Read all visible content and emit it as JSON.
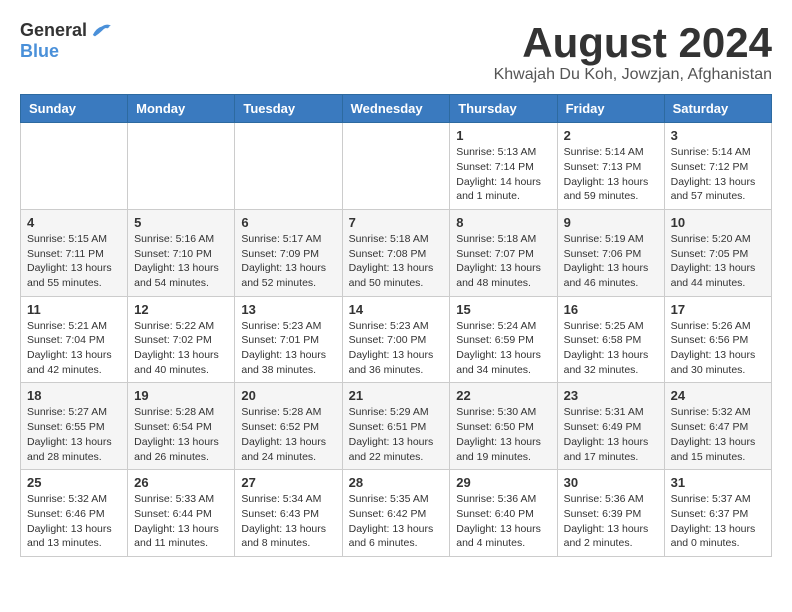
{
  "header": {
    "logo": {
      "general": "General",
      "blue": "Blue"
    },
    "title": "August 2024",
    "location": "Khwajah Du Koh, Jowzjan, Afghanistan"
  },
  "weekdays": [
    "Sunday",
    "Monday",
    "Tuesday",
    "Wednesday",
    "Thursday",
    "Friday",
    "Saturday"
  ],
  "weeks": [
    [
      {
        "day": "",
        "info": ""
      },
      {
        "day": "",
        "info": ""
      },
      {
        "day": "",
        "info": ""
      },
      {
        "day": "",
        "info": ""
      },
      {
        "day": "1",
        "info": "Sunrise: 5:13 AM\nSunset: 7:14 PM\nDaylight: 14 hours\nand 1 minute."
      },
      {
        "day": "2",
        "info": "Sunrise: 5:14 AM\nSunset: 7:13 PM\nDaylight: 13 hours\nand 59 minutes."
      },
      {
        "day": "3",
        "info": "Sunrise: 5:14 AM\nSunset: 7:12 PM\nDaylight: 13 hours\nand 57 minutes."
      }
    ],
    [
      {
        "day": "4",
        "info": "Sunrise: 5:15 AM\nSunset: 7:11 PM\nDaylight: 13 hours\nand 55 minutes."
      },
      {
        "day": "5",
        "info": "Sunrise: 5:16 AM\nSunset: 7:10 PM\nDaylight: 13 hours\nand 54 minutes."
      },
      {
        "day": "6",
        "info": "Sunrise: 5:17 AM\nSunset: 7:09 PM\nDaylight: 13 hours\nand 52 minutes."
      },
      {
        "day": "7",
        "info": "Sunrise: 5:18 AM\nSunset: 7:08 PM\nDaylight: 13 hours\nand 50 minutes."
      },
      {
        "day": "8",
        "info": "Sunrise: 5:18 AM\nSunset: 7:07 PM\nDaylight: 13 hours\nand 48 minutes."
      },
      {
        "day": "9",
        "info": "Sunrise: 5:19 AM\nSunset: 7:06 PM\nDaylight: 13 hours\nand 46 minutes."
      },
      {
        "day": "10",
        "info": "Sunrise: 5:20 AM\nSunset: 7:05 PM\nDaylight: 13 hours\nand 44 minutes."
      }
    ],
    [
      {
        "day": "11",
        "info": "Sunrise: 5:21 AM\nSunset: 7:04 PM\nDaylight: 13 hours\nand 42 minutes."
      },
      {
        "day": "12",
        "info": "Sunrise: 5:22 AM\nSunset: 7:02 PM\nDaylight: 13 hours\nand 40 minutes."
      },
      {
        "day": "13",
        "info": "Sunrise: 5:23 AM\nSunset: 7:01 PM\nDaylight: 13 hours\nand 38 minutes."
      },
      {
        "day": "14",
        "info": "Sunrise: 5:23 AM\nSunset: 7:00 PM\nDaylight: 13 hours\nand 36 minutes."
      },
      {
        "day": "15",
        "info": "Sunrise: 5:24 AM\nSunset: 6:59 PM\nDaylight: 13 hours\nand 34 minutes."
      },
      {
        "day": "16",
        "info": "Sunrise: 5:25 AM\nSunset: 6:58 PM\nDaylight: 13 hours\nand 32 minutes."
      },
      {
        "day": "17",
        "info": "Sunrise: 5:26 AM\nSunset: 6:56 PM\nDaylight: 13 hours\nand 30 minutes."
      }
    ],
    [
      {
        "day": "18",
        "info": "Sunrise: 5:27 AM\nSunset: 6:55 PM\nDaylight: 13 hours\nand 28 minutes."
      },
      {
        "day": "19",
        "info": "Sunrise: 5:28 AM\nSunset: 6:54 PM\nDaylight: 13 hours\nand 26 minutes."
      },
      {
        "day": "20",
        "info": "Sunrise: 5:28 AM\nSunset: 6:52 PM\nDaylight: 13 hours\nand 24 minutes."
      },
      {
        "day": "21",
        "info": "Sunrise: 5:29 AM\nSunset: 6:51 PM\nDaylight: 13 hours\nand 22 minutes."
      },
      {
        "day": "22",
        "info": "Sunrise: 5:30 AM\nSunset: 6:50 PM\nDaylight: 13 hours\nand 19 minutes."
      },
      {
        "day": "23",
        "info": "Sunrise: 5:31 AM\nSunset: 6:49 PM\nDaylight: 13 hours\nand 17 minutes."
      },
      {
        "day": "24",
        "info": "Sunrise: 5:32 AM\nSunset: 6:47 PM\nDaylight: 13 hours\nand 15 minutes."
      }
    ],
    [
      {
        "day": "25",
        "info": "Sunrise: 5:32 AM\nSunset: 6:46 PM\nDaylight: 13 hours\nand 13 minutes."
      },
      {
        "day": "26",
        "info": "Sunrise: 5:33 AM\nSunset: 6:44 PM\nDaylight: 13 hours\nand 11 minutes."
      },
      {
        "day": "27",
        "info": "Sunrise: 5:34 AM\nSunset: 6:43 PM\nDaylight: 13 hours\nand 8 minutes."
      },
      {
        "day": "28",
        "info": "Sunrise: 5:35 AM\nSunset: 6:42 PM\nDaylight: 13 hours\nand 6 minutes."
      },
      {
        "day": "29",
        "info": "Sunrise: 5:36 AM\nSunset: 6:40 PM\nDaylight: 13 hours\nand 4 minutes."
      },
      {
        "day": "30",
        "info": "Sunrise: 5:36 AM\nSunset: 6:39 PM\nDaylight: 13 hours\nand 2 minutes."
      },
      {
        "day": "31",
        "info": "Sunrise: 5:37 AM\nSunset: 6:37 PM\nDaylight: 13 hours\nand 0 minutes."
      }
    ]
  ]
}
